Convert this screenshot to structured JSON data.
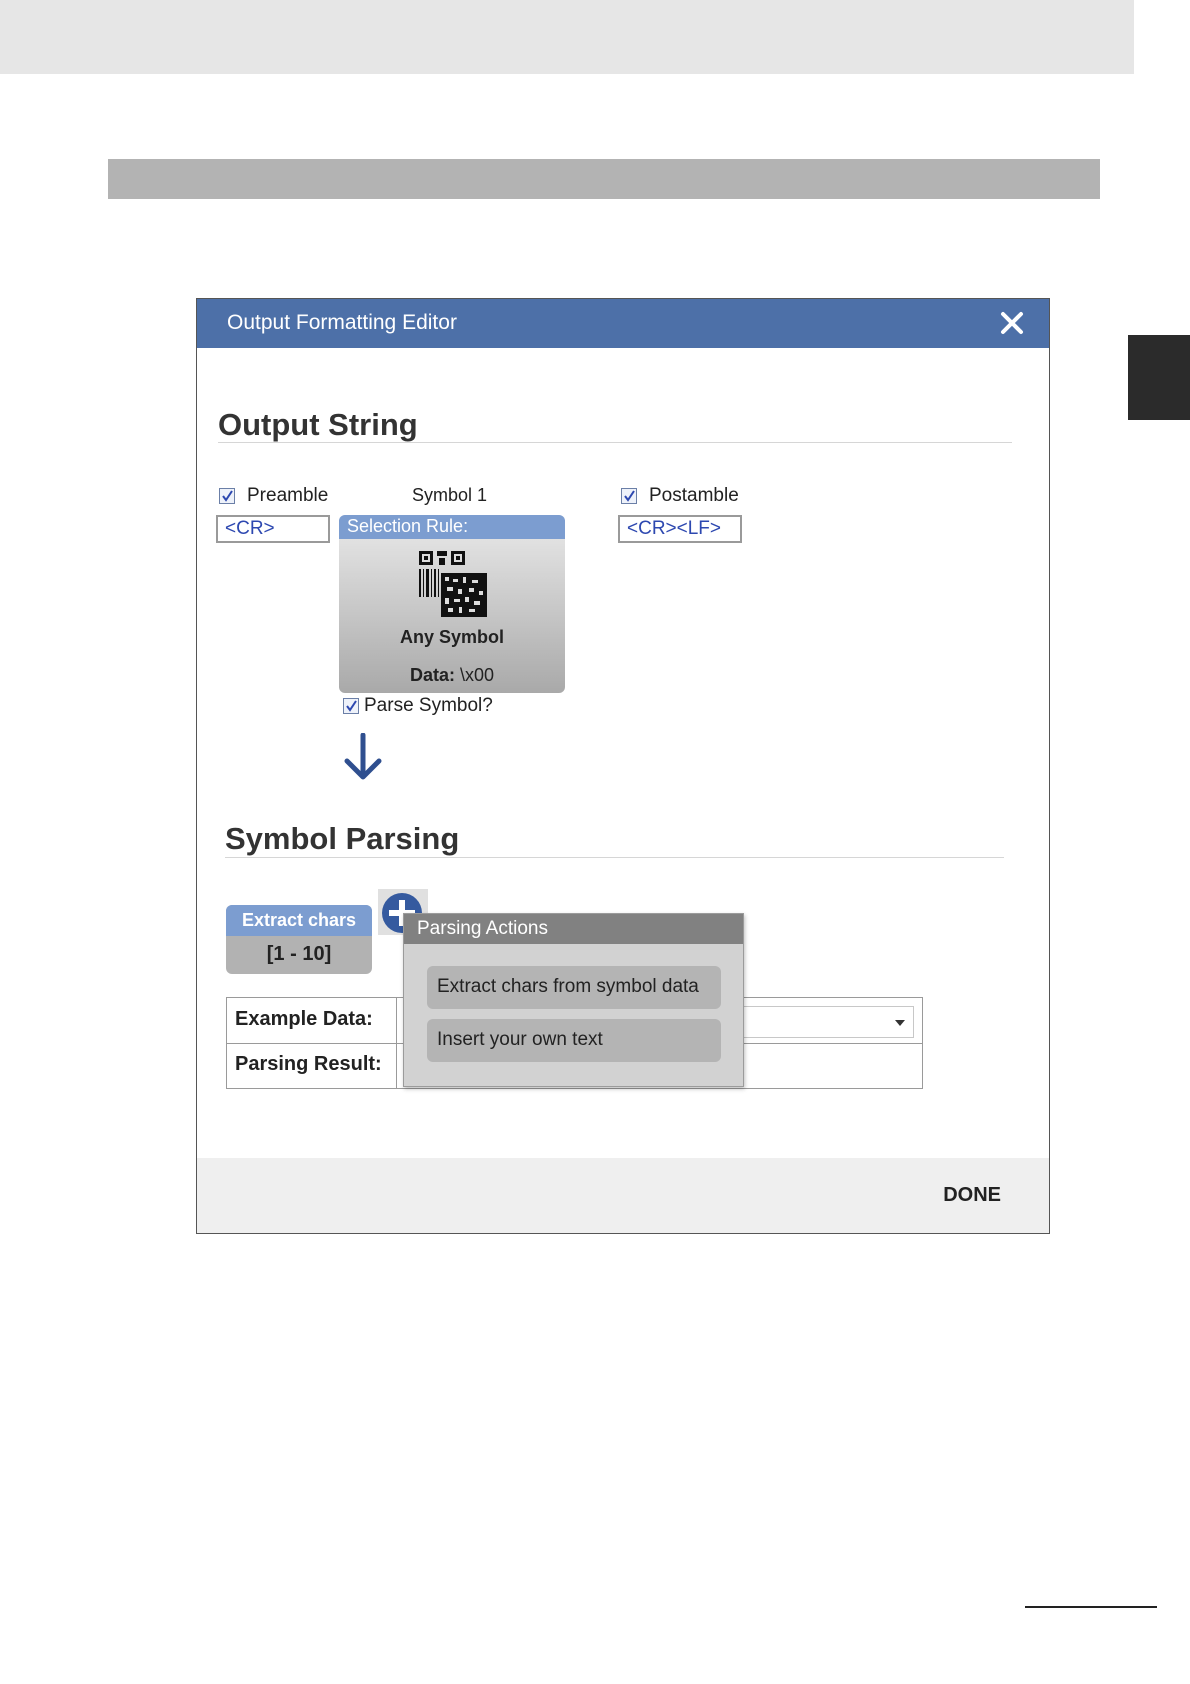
{
  "dialog": {
    "title": "Output Formatting Editor",
    "accent_color": "#4d70a8"
  },
  "output_string": {
    "heading": "Output String",
    "preamble": {
      "label": "Preamble",
      "checked": true,
      "value": "<CR>"
    },
    "symbol": {
      "label": "Symbol 1",
      "selection_rule_label": "Selection Rule:",
      "name": "Any Symbol",
      "data_label": "Data:",
      "data_value": "\\x00",
      "icon": "barcode-icon"
    },
    "postamble": {
      "label": "Postamble",
      "checked": true,
      "value": "<CR><LF>"
    },
    "parse_symbol": {
      "label": "Parse Symbol?",
      "checked": true
    }
  },
  "symbol_parsing": {
    "heading": "Symbol Parsing",
    "action_card": {
      "title": "Extract chars",
      "range": "[1 - 10]"
    },
    "example_data_label": "Example Data:",
    "parsing_result_label": "Parsing Result:"
  },
  "parsing_actions": {
    "title": "Parsing Actions",
    "items": [
      {
        "label": "Extract chars from symbol data"
      },
      {
        "label": "Insert your own text"
      }
    ]
  },
  "footer": {
    "done_label": "DONE"
  }
}
